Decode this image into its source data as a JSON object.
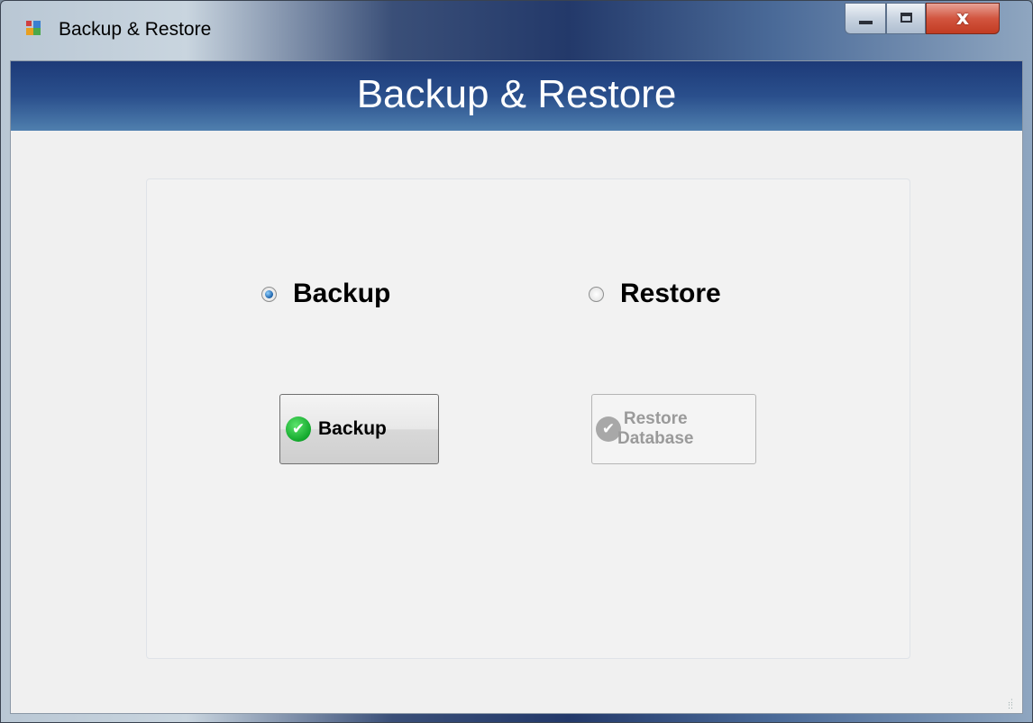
{
  "window": {
    "title": "Backup & Restore",
    "controls": {
      "minimize": "minimize",
      "maximize": "maximize",
      "close": "x"
    }
  },
  "header": {
    "title": "Backup & Restore"
  },
  "options": {
    "backup_label": "Backup",
    "restore_label": "Restore",
    "selected": "Backup"
  },
  "buttons": {
    "backup_label": "Backup",
    "restore_line1": "Restore",
    "restore_line2": "Database",
    "restore_enabled": false
  },
  "colors": {
    "header_gradient_top": "#1d3a78",
    "header_gradient_bottom": "#4f7fae",
    "check_green": "#12a82c",
    "disabled_text": "#9a9a9a"
  }
}
